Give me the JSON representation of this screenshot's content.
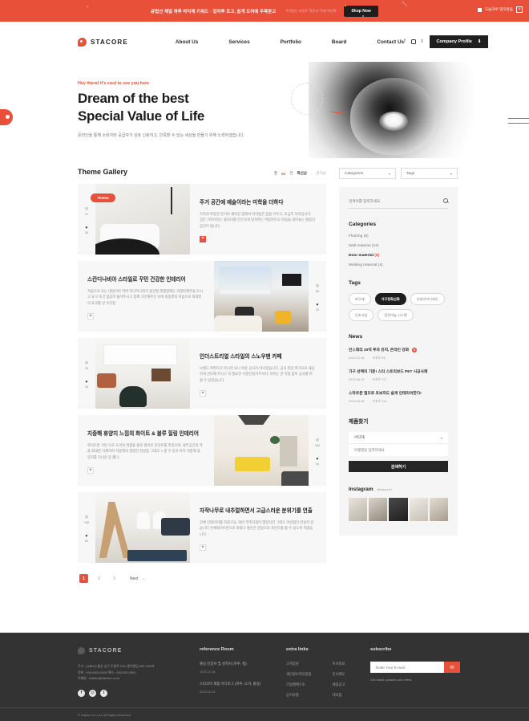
{
  "promo": {
    "text": "유럽산 제일 하루 바닥재 키워드 · 집마루 트고, 쉽게 도어에 주목받고",
    "subtext": "주목받는 포인트 학장과 '학재 백년화'",
    "button": "Shop Now",
    "dismiss_label": "오늘하루 열지않음",
    "close_icon": "×"
  },
  "header": {
    "brand": "STACORE",
    "nav": [
      {
        "label": "About Us"
      },
      {
        "label": "Services"
      },
      {
        "label": "Portfolio"
      },
      {
        "label": "Board"
      },
      {
        "label": "Contact Us"
      }
    ],
    "social": [
      {
        "name": "facebook-icon",
        "glyph": "f"
      },
      {
        "name": "instagram-icon",
        "glyph": ""
      },
      {
        "name": "twitter-icon",
        "glyph": "t"
      }
    ],
    "profile_button": "Company Profile",
    "download_icon": "⬇"
  },
  "hero": {
    "kicker": "Hey there! it's cool to see you here",
    "title_line1": "Dream of the best",
    "title_line2": "Special Value of Life",
    "description": "온라인을 통해 소비자와 공급자가 상호 신뢰하고, 만족할 수 있는 세상을 만들기 위해 노력하겠습니다."
  },
  "gallery": {
    "title": "Theme Gallery",
    "count_label": "총",
    "count_value": "53",
    "count_unit": "건",
    "sort_latest": "최신순",
    "sort_popular": "인기순",
    "badge": "Theme",
    "cards": [
      {
        "title": "주거 공간에 예술이라는 미학을 더하다",
        "desc": "가족의 따뜻한 온기로 채워진 집에서 아이들은 꿈을 키우고, 조급히 자라납니다. 집은 가족이라는 울타리를 든든하게 받쳐주는 버팀목이고 마음을 내려놓는 힐링의 공간이 됩니다.",
        "views": "12",
        "likes": "28",
        "plus": "+",
        "layout": "image-left",
        "badge": true
      },
      {
        "title": "스칸디나비아 스타일로 꾸민 건강한 인테리어",
        "desc": "처음으로 오는 내담이라 하며 하나하나까지 정건질 해결함에도 귀찮아해주실 오시고 요구 조건 꼼꼼히 들어주시고 함께 고민해주신 덕에 최종편의 마음으로 최대한의 효과를 낸 우리집",
        "views": "83",
        "likes": "32",
        "plus": "+",
        "layout": "image-right",
        "badge": false
      },
      {
        "title": "인더스트리얼 스타일의 스노우맨 카페",
        "desc": "브랜드 아파트가 아니라 보니 쉬운 공사가 아니었습니다. 공사 현장 여기오로 세심하게 관리해 주시고 꼭 필요한 사항인정거주셔서, 저희는 큰 걱정 없이 공사를 마칠 수 있었습니다.",
        "views": "78",
        "likes": "16",
        "plus": "+",
        "layout": "image-left",
        "badge": false
      },
      {
        "title": "지중해 휴양지 느낌의 화이트 & 블루 힐링 인테리어",
        "desc": "화이트톤 기반 으로 도어의 색깔을 블루 컬러로 포인트를 주었으며, 내부공간의 색을 최대한 자제하여 지중해의 청량한 감성을 그대로 느낄 수 있어 마치 지중해 휴양지를 다녀온 듯 했다.",
        "views": "102",
        "likes": "44",
        "plus": "+",
        "layout": "image-right",
        "badge": false
      },
      {
        "title": "자작나무로 내추럴하면서 고급스러운 분위기를 연출",
        "desc": "전체 인테리어를 하였구요, 여러 부족지정이 많았지만 그래도 이런점이 만설치 있습니다 전체화이트톤으로 화얗고 좋은은 감정으로 포인트를 줄 수 있도록 하였습니다.",
        "views": "135",
        "likes": "52",
        "plus": "+",
        "layout": "image-left",
        "badge": false
      }
    ],
    "pagination": {
      "pages": [
        "1",
        "2",
        "3"
      ],
      "active": "1",
      "next": "Next",
      "next_icon": "→"
    }
  },
  "sidebar": {
    "filter_categories": "Categories",
    "filter_tags": "Tags",
    "search_placeholder": "검색어를 입력하세요.",
    "search_icon": "search-icon",
    "categories_heading": "Categories",
    "categories": [
      {
        "label": "Flooring",
        "count": "(8)",
        "active": false
      },
      {
        "label": "Wall material",
        "count": "(12)",
        "active": false
      },
      {
        "label": "Door material",
        "count": "(6)",
        "active": true
      },
      {
        "label": "Molding material",
        "count": "(4)",
        "active": false
      }
    ],
    "tags_heading": "Tags",
    "tags": [
      {
        "label": "바닥재",
        "active": false
      },
      {
        "label": "가구정화산화",
        "active": true
      },
      {
        "label": "인테리어디자인",
        "active": false
      },
      {
        "label": "인조사업",
        "active": false
      },
      {
        "label": "알루미늄 시스템",
        "active": false
      }
    ],
    "news_heading": "News",
    "news": [
      {
        "title": "인스테리 20억 투자 유치, 온라인 강화",
        "new": true,
        "date": "2023.12.28",
        "views": "조회수 86"
      },
      {
        "title": "가구 선택의 기준! 스타 스토리보드 PET 시공사례",
        "new": false,
        "date": "2023.08.15",
        "views": "조회수 117"
      },
      {
        "title": "스마트폰 앱으로 초보자도 쉽게 인테리어한다!",
        "new": false,
        "date": "2023.03.08",
        "views": "조회수 116"
      }
    ],
    "find_heading": "제품찾기",
    "find_select": "바닥재",
    "find_placeholder": "모델명을 입력하세요.",
    "find_button": "검색하기",
    "instagram_heading": "Instagram",
    "instagram_handle": "@stacore1"
  },
  "footer": {
    "brand": "STACORE",
    "address_lines": [
      "주소 : (44611) 울산 남구 두왕로 129, 벤처빌딩 602~603호",
      "전화 : 000-0000-0000    팩스 : 000-000-0000",
      "이메일 : master@stacore.co.kr"
    ],
    "social": [
      {
        "name": "facebook-icon",
        "glyph": "f"
      },
      {
        "name": "instagram-icon",
        "glyph": "◎"
      },
      {
        "name": "twitter-icon",
        "glyph": "t"
      }
    ],
    "reference_heading": "reference Room",
    "reference_items": [
      {
        "title": "몰딩 인증서 및 성적서 (마루, 힐)",
        "date": "2023.12.18"
      },
      {
        "title": "스타코어 제품 카다로그 (마루, 도어, 몰딩)",
        "date": "2023.10.23"
      }
    ],
    "extra_heading": "extra links",
    "extra_links": [
      {
        "label": "고객상담"
      },
      {
        "label": "개인정보처리방침"
      },
      {
        "label": "기업제배구조"
      },
      {
        "label": "공지사항"
      }
    ],
    "extra_links2": [
      {
        "label": "투자정보"
      },
      {
        "label": "인사제도"
      },
      {
        "label": "채용공고"
      },
      {
        "label": "대리점"
      }
    ],
    "subscribe_heading": "subscribe",
    "subscribe_placeholder": "Enter Your E-mail",
    "subscribe_icon": "✉",
    "subscribe_note": "Get latest updates and offers.",
    "copyright": "© Haplux Co.,Ltd. All Rights Reserved."
  },
  "colors": {
    "accent": "#e8503a",
    "dark": "#333333",
    "text": "#1d1d1d"
  }
}
